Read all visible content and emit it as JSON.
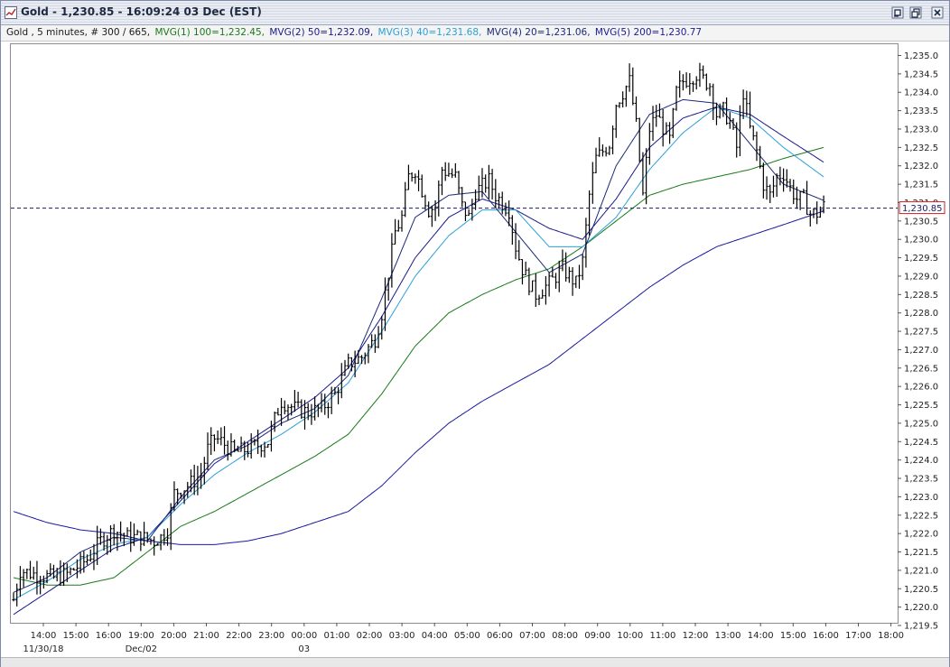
{
  "window": {
    "title": "Gold - 1,230.85 - 16:09:24  03 Dec (EST)"
  },
  "legend": {
    "instrument": "Gold , 5 minutes, # 300 / 665,",
    "ma1": "MVG(1) 100=1,232.45,",
    "ma2": "MVG(2) 50=1,232.09,",
    "ma3": "MVG(3) 40=1,231.68,",
    "ma4": "MVG(4) 20=1,231.06,",
    "ma5": "MVG(5) 200=1,230.77"
  },
  "colors": {
    "ma1": "#1a7a1a",
    "ma2": "#1a1a8c",
    "ma3": "#2aa0d8",
    "ma4": "#1a2a7a",
    "ma5": "#1a1aa0",
    "price": "#000000",
    "last_line": "#1a1a6a",
    "last_box": "#d02020"
  },
  "chart_data": {
    "type": "ohlc",
    "interval": "5 minutes",
    "last_price": "1,230.85",
    "ylim": [
      1219.5,
      1235.0
    ],
    "y_step": 0.5,
    "x_ticks": [
      "14:00",
      "15:00",
      "16:00",
      "19:00",
      "20:00",
      "21:00",
      "22:00",
      "23:00",
      "00:00",
      "01:00",
      "02:00",
      "03:00",
      "04:00",
      "05:00",
      "06:00",
      "07:00",
      "08:00",
      "09:00",
      "10:00",
      "11:00",
      "12:00",
      "13:00",
      "14:00",
      "15:00",
      "16:00",
      "17:00",
      "18:00"
    ],
    "date_labels": [
      {
        "text": "11/30/18",
        "at": "14:00"
      },
      {
        "text": "Dec/02",
        "at": "19:00"
      },
      {
        "text": "03",
        "at": "00:00"
      }
    ],
    "close_anchors": [
      [
        0,
        1220.2
      ],
      [
        2,
        1221.0
      ],
      [
        6,
        1220.9
      ],
      [
        12,
        1220.8
      ],
      [
        16,
        1220.9
      ],
      [
        22,
        1221.3
      ],
      [
        26,
        1221.8
      ],
      [
        30,
        1222.1
      ],
      [
        34,
        1221.9
      ],
      [
        38,
        1221.9
      ],
      [
        42,
        1221.8
      ],
      [
        44,
        1221.9
      ],
      [
        46,
        1222.1
      ],
      [
        48,
        1223.1
      ],
      [
        52,
        1223.3
      ],
      [
        56,
        1223.6
      ],
      [
        58,
        1224.3
      ],
      [
        60,
        1224.6
      ],
      [
        62,
        1224.5
      ],
      [
        66,
        1224.2
      ],
      [
        70,
        1224.3
      ],
      [
        76,
        1224.5
      ],
      [
        78,
        1225.1
      ],
      [
        80,
        1225.6
      ],
      [
        84,
        1225.4
      ],
      [
        88,
        1225.3
      ],
      [
        92,
        1225.4
      ],
      [
        96,
        1225.8
      ],
      [
        100,
        1226.6
      ],
      [
        104,
        1226.8
      ],
      [
        108,
        1227.3
      ],
      [
        110,
        1228.0
      ],
      [
        112,
        1229.1
      ],
      [
        114,
        1230.2
      ],
      [
        116,
        1230.6
      ],
      [
        118,
        1231.7
      ],
      [
        120,
        1231.9
      ],
      [
        124,
        1230.8
      ],
      [
        126,
        1230.9
      ],
      [
        128,
        1231.9
      ],
      [
        132,
        1231.7
      ],
      [
        134,
        1230.9
      ],
      [
        136,
        1230.6
      ],
      [
        138,
        1231.3
      ],
      [
        142,
        1231.6
      ],
      [
        144,
        1231.2
      ],
      [
        148,
        1230.8
      ],
      [
        150,
        1229.8
      ],
      [
        152,
        1229.2
      ],
      [
        154,
        1228.8
      ],
      [
        156,
        1228.5
      ],
      [
        160,
        1228.8
      ],
      [
        164,
        1229.2
      ],
      [
        166,
        1229.0
      ],
      [
        168,
        1228.8
      ],
      [
        170,
        1229.4
      ],
      [
        172,
        1231.2
      ],
      [
        174,
        1232.2
      ],
      [
        178,
        1232.6
      ],
      [
        180,
        1233.7
      ],
      [
        184,
        1234.3
      ],
      [
        186,
        1233.1
      ],
      [
        188,
        1231.2
      ],
      [
        190,
        1233.0
      ],
      [
        192,
        1233.4
      ],
      [
        196,
        1232.7
      ],
      [
        198,
        1234.0
      ],
      [
        200,
        1234.3
      ],
      [
        204,
        1234.5
      ],
      [
        208,
        1234.2
      ],
      [
        210,
        1233.4
      ],
      [
        212,
        1233.5
      ],
      [
        214,
        1233.2
      ],
      [
        216,
        1232.5
      ],
      [
        218,
        1234.0
      ],
      [
        220,
        1233.0
      ],
      [
        222,
        1232.4
      ],
      [
        224,
        1231.5
      ],
      [
        226,
        1231.2
      ],
      [
        228,
        1231.7
      ],
      [
        230,
        1231.8
      ],
      [
        232,
        1231.4
      ],
      [
        234,
        1231.1
      ],
      [
        236,
        1231.1
      ],
      [
        238,
        1230.7
      ],
      [
        240,
        1230.7
      ],
      [
        242,
        1230.9
      ]
    ],
    "ma_anchors": {
      "ma1": [
        [
          0,
          1220.8
        ],
        [
          10,
          1220.6
        ],
        [
          20,
          1220.6
        ],
        [
          30,
          1220.8
        ],
        [
          40,
          1221.5
        ],
        [
          50,
          1222.2
        ],
        [
          60,
          1222.6
        ],
        [
          70,
          1223.1
        ],
        [
          80,
          1223.6
        ],
        [
          90,
          1224.1
        ],
        [
          100,
          1224.7
        ],
        [
          110,
          1225.8
        ],
        [
          120,
          1227.1
        ],
        [
          130,
          1228.0
        ],
        [
          140,
          1228.5
        ],
        [
          150,
          1228.9
        ],
        [
          160,
          1229.2
        ],
        [
          170,
          1229.8
        ],
        [
          180,
          1230.5
        ],
        [
          190,
          1231.2
        ],
        [
          200,
          1231.5
        ],
        [
          210,
          1231.7
        ],
        [
          220,
          1231.9
        ],
        [
          230,
          1232.2
        ],
        [
          242,
          1232.5
        ]
      ],
      "ma2": [
        [
          0,
          1219.8
        ],
        [
          10,
          1220.4
        ],
        [
          20,
          1221.0
        ],
        [
          30,
          1221.6
        ],
        [
          40,
          1221.9
        ],
        [
          50,
          1222.9
        ],
        [
          60,
          1223.9
        ],
        [
          70,
          1224.5
        ],
        [
          80,
          1225.1
        ],
        [
          90,
          1225.7
        ],
        [
          100,
          1226.5
        ],
        [
          110,
          1227.9
        ],
        [
          120,
          1229.5
        ],
        [
          130,
          1230.6
        ],
        [
          140,
          1231.1
        ],
        [
          150,
          1230.8
        ],
        [
          160,
          1230.3
        ],
        [
          170,
          1230.0
        ],
        [
          180,
          1231.1
        ],
        [
          190,
          1232.5
        ],
        [
          200,
          1233.3
        ],
        [
          210,
          1233.6
        ],
        [
          220,
          1233.4
        ],
        [
          230,
          1232.8
        ],
        [
          242,
          1232.1
        ]
      ],
      "ma3": [
        [
          0,
          1220.2
        ],
        [
          10,
          1220.7
        ],
        [
          20,
          1221.3
        ],
        [
          30,
          1221.7
        ],
        [
          40,
          1221.9
        ],
        [
          50,
          1222.8
        ],
        [
          60,
          1223.6
        ],
        [
          70,
          1224.2
        ],
        [
          80,
          1224.7
        ],
        [
          90,
          1225.3
        ],
        [
          100,
          1226.1
        ],
        [
          110,
          1227.5
        ],
        [
          120,
          1229.0
        ],
        [
          130,
          1230.1
        ],
        [
          140,
          1230.8
        ],
        [
          150,
          1230.8
        ],
        [
          160,
          1229.8
        ],
        [
          170,
          1229.8
        ],
        [
          180,
          1230.6
        ],
        [
          190,
          1231.9
        ],
        [
          200,
          1232.9
        ],
        [
          210,
          1233.6
        ],
        [
          220,
          1233.3
        ],
        [
          230,
          1232.5
        ],
        [
          242,
          1231.7
        ]
      ],
      "ma4": [
        [
          0,
          1220.4
        ],
        [
          10,
          1220.8
        ],
        [
          20,
          1221.5
        ],
        [
          30,
          1221.9
        ],
        [
          40,
          1221.8
        ],
        [
          50,
          1223.0
        ],
        [
          60,
          1224.0
        ],
        [
          70,
          1224.4
        ],
        [
          80,
          1225.0
        ],
        [
          90,
          1225.4
        ],
        [
          100,
          1226.3
        ],
        [
          110,
          1228.4
        ],
        [
          120,
          1230.6
        ],
        [
          130,
          1231.2
        ],
        [
          140,
          1231.3
        ],
        [
          150,
          1230.2
        ],
        [
          160,
          1229.1
        ],
        [
          170,
          1229.6
        ],
        [
          180,
          1232.0
        ],
        [
          190,
          1233.4
        ],
        [
          200,
          1233.8
        ],
        [
          210,
          1233.7
        ],
        [
          220,
          1232.6
        ],
        [
          230,
          1231.5
        ],
        [
          242,
          1231.06
        ]
      ],
      "ma5": [
        [
          0,
          1222.6
        ],
        [
          10,
          1222.3
        ],
        [
          20,
          1222.1
        ],
        [
          30,
          1222.0
        ],
        [
          40,
          1221.8
        ],
        [
          50,
          1221.7
        ],
        [
          60,
          1221.7
        ],
        [
          70,
          1221.8
        ],
        [
          80,
          1222.0
        ],
        [
          90,
          1222.3
        ],
        [
          100,
          1222.6
        ],
        [
          110,
          1223.3
        ],
        [
          120,
          1224.2
        ],
        [
          130,
          1225.0
        ],
        [
          140,
          1225.6
        ],
        [
          150,
          1226.1
        ],
        [
          160,
          1226.6
        ],
        [
          170,
          1227.3
        ],
        [
          180,
          1228.0
        ],
        [
          190,
          1228.7
        ],
        [
          200,
          1229.3
        ],
        [
          210,
          1229.8
        ],
        [
          220,
          1230.1
        ],
        [
          230,
          1230.4
        ],
        [
          242,
          1230.77
        ]
      ]
    }
  }
}
